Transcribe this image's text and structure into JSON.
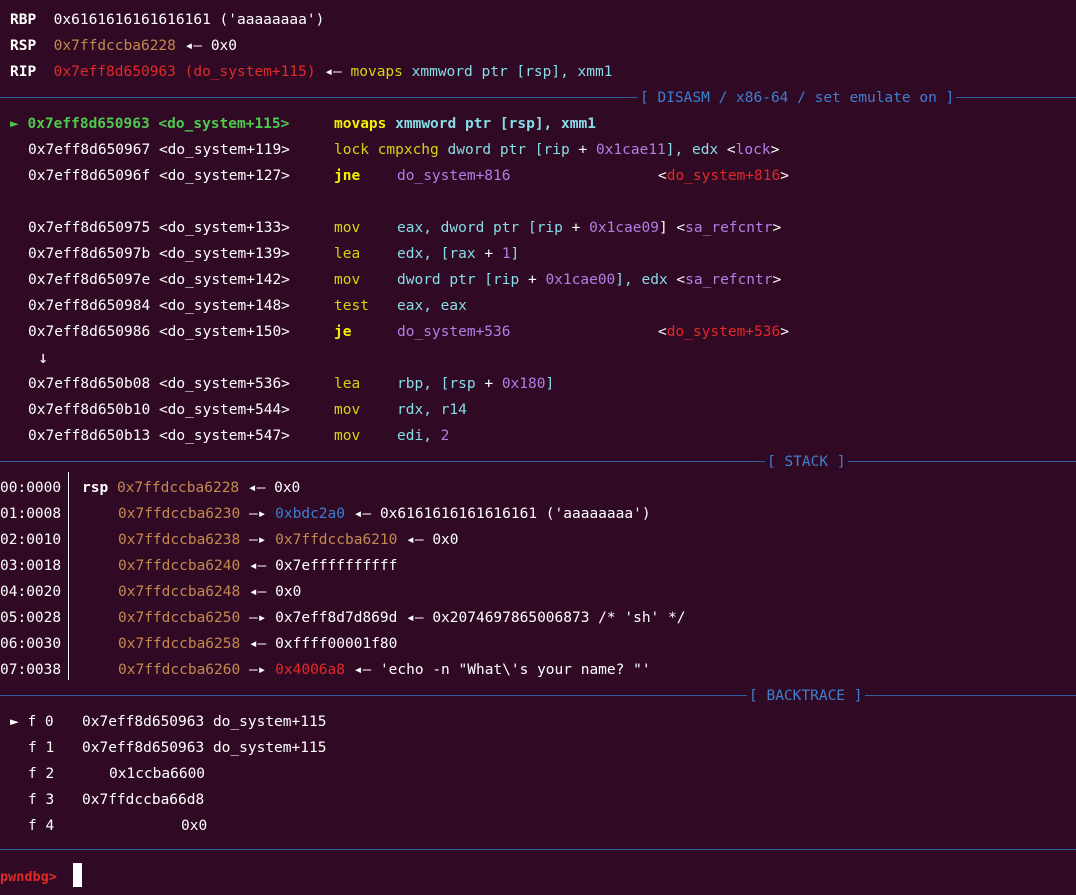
{
  "registers": {
    "rbp": {
      "name": "RBP",
      "value": "0x6161616161616161 ('aaaaaaaa')"
    },
    "rsp": {
      "name": "RSP",
      "addr": "0x7ffdccba6228",
      "arrow": "◂—",
      "value": "0x0"
    },
    "rip": {
      "name": "RIP",
      "addr": "0x7eff8d650963 (do_system+115)",
      "arrow": "◂—",
      "mnemonic": "movaps",
      "ops1": "xmmword ptr [",
      "reg1": "rsp",
      "ops2": "], ",
      "reg2": "xmm1"
    }
  },
  "sections": {
    "disasm": "[ DISASM / x86-64 / set emulate on ]",
    "stack": "[ STACK ]",
    "backtrace": "[ BACKTRACE ]"
  },
  "disasm": {
    "current_marker": "►",
    "jump_arrow": "↓",
    "lines": [
      {
        "addr": "0x7eff8d650963",
        "sym": "<do_system+115>"
      },
      {
        "addr": "0x7eff8d650967",
        "sym": "<do_system+119>"
      },
      {
        "addr": "0x7eff8d65096f",
        "sym": "<do_system+127>"
      },
      {
        "addr": "0x7eff8d650975",
        "sym": "<do_system+133>"
      },
      {
        "addr": "0x7eff8d65097b",
        "sym": "<do_system+139>"
      },
      {
        "addr": "0x7eff8d65097e",
        "sym": "<do_system+142>"
      },
      {
        "addr": "0x7eff8d650984",
        "sym": "<do_system+148>"
      },
      {
        "addr": "0x7eff8d650986",
        "sym": "<do_system+150>"
      },
      {
        "addr": "0x7eff8d650b08",
        "sym": "<do_system+536>"
      },
      {
        "addr": "0x7eff8d650b10",
        "sym": "<do_system+544>"
      },
      {
        "addr": "0x7eff8d650b13",
        "sym": "<do_system+547>"
      }
    ],
    "i0": {
      "mn": "movaps",
      "a": "xmmword ptr [",
      "b": "rsp",
      "c": "], ",
      "d": "xmm1"
    },
    "i1": {
      "mn": "lock",
      "mn2": "cmpxchg",
      "a": "dword ptr [",
      "b": "rip",
      "c": " + ",
      "d": "0x1cae11",
      "e": "], ",
      "f": "edx",
      "g": " <",
      "h": "lock",
      "i": ">"
    },
    "i2": {
      "mn": "jne",
      "a": "do_system+816",
      "b": "<",
      "c": "do_system+816",
      "d": ">"
    },
    "i3": {
      "mn": "mov",
      "a": "eax",
      "b": ", dword ptr [",
      "c": "rip",
      "d": " + ",
      "e": "0x1cae09",
      "f": "] <",
      "g": "sa_refcntr",
      "h": ">"
    },
    "i4": {
      "mn": "lea",
      "a": "edx",
      "b": ", [",
      "c": "rax",
      "d": " + ",
      "e": "1",
      "f": "]"
    },
    "i5": {
      "mn": "mov",
      "a": "dword ptr [",
      "b": "rip",
      "c": " + ",
      "d": "0x1cae00",
      "e": "], ",
      "f": "edx",
      "g": " <",
      "h": "sa_refcntr",
      "i": ">"
    },
    "i6": {
      "mn": "test",
      "a": "eax",
      "b": ", ",
      "c": "eax"
    },
    "i7": {
      "mn": "je",
      "a": "do_system+536",
      "b": "<",
      "c": "do_system+536",
      "d": ">"
    },
    "i8": {
      "mn": "lea",
      "a": "rbp",
      "b": ", [",
      "c": "rsp",
      "d": " + ",
      "e": "0x180",
      "f": "]"
    },
    "i9": {
      "mn": "mov",
      "a": "rdx",
      "b": ", ",
      "c": "r14"
    },
    "i10": {
      "mn": "mov",
      "a": "edi",
      "b": ", ",
      "c": "2"
    }
  },
  "stack": [
    {
      "off": "00:0000",
      "reg": "rsp",
      "addr": "0x7ffdccba6228",
      "arrow": "◂—",
      "v1": "0x0"
    },
    {
      "off": "01:0008",
      "addr": "0x7ffdccba6230",
      "arrow": "—▸",
      "v1": "0xbdc2a0",
      "arrow2": "◂—",
      "v2": "0x6161616161616161 ('aaaaaaaa')"
    },
    {
      "off": "02:0010",
      "addr": "0x7ffdccba6238",
      "arrow": "—▸",
      "v1": "0x7ffdccba6210",
      "arrow2": "◂—",
      "v2": "0x0"
    },
    {
      "off": "03:0018",
      "addr": "0x7ffdccba6240",
      "arrow": "◂—",
      "v1": "0x7effffffffff"
    },
    {
      "off": "04:0020",
      "addr": "0x7ffdccba6248",
      "arrow": "◂—",
      "v1": "0x0"
    },
    {
      "off": "05:0028",
      "addr": "0x7ffdccba6250",
      "arrow": "—▸",
      "v1": "0x7eff8d7d869d",
      "arrow2": "◂—",
      "v2": "0x2074697865006873 /* 'sh' */"
    },
    {
      "off": "06:0030",
      "addr": "0x7ffdccba6258",
      "arrow": "◂—",
      "v1": "0xffff00001f80"
    },
    {
      "off": "07:0038",
      "addr": "0x7ffdccba6260",
      "arrow": "—▸",
      "v1": "0x4006a8",
      "arrow2": "◂—",
      "v2": "'echo -n \"What\\'s your name? \"'"
    }
  ],
  "backtrace": [
    {
      "marker": "►",
      "frame": "f 0",
      "addr": "0x7eff8d650963",
      "sym": "do_system+115"
    },
    {
      "marker": "",
      "frame": "f 1",
      "addr": "0x7eff8d650963",
      "sym": "do_system+115"
    },
    {
      "marker": "",
      "frame": "f 2",
      "addr": "0x1ccba6600",
      "sym": ""
    },
    {
      "marker": "",
      "frame": "f 3",
      "addr": "0x7ffdccba66d8",
      "sym": ""
    },
    {
      "marker": "",
      "frame": "f 4",
      "addr": "0x0",
      "sym": ""
    }
  ],
  "prompt": "pwndbg>"
}
